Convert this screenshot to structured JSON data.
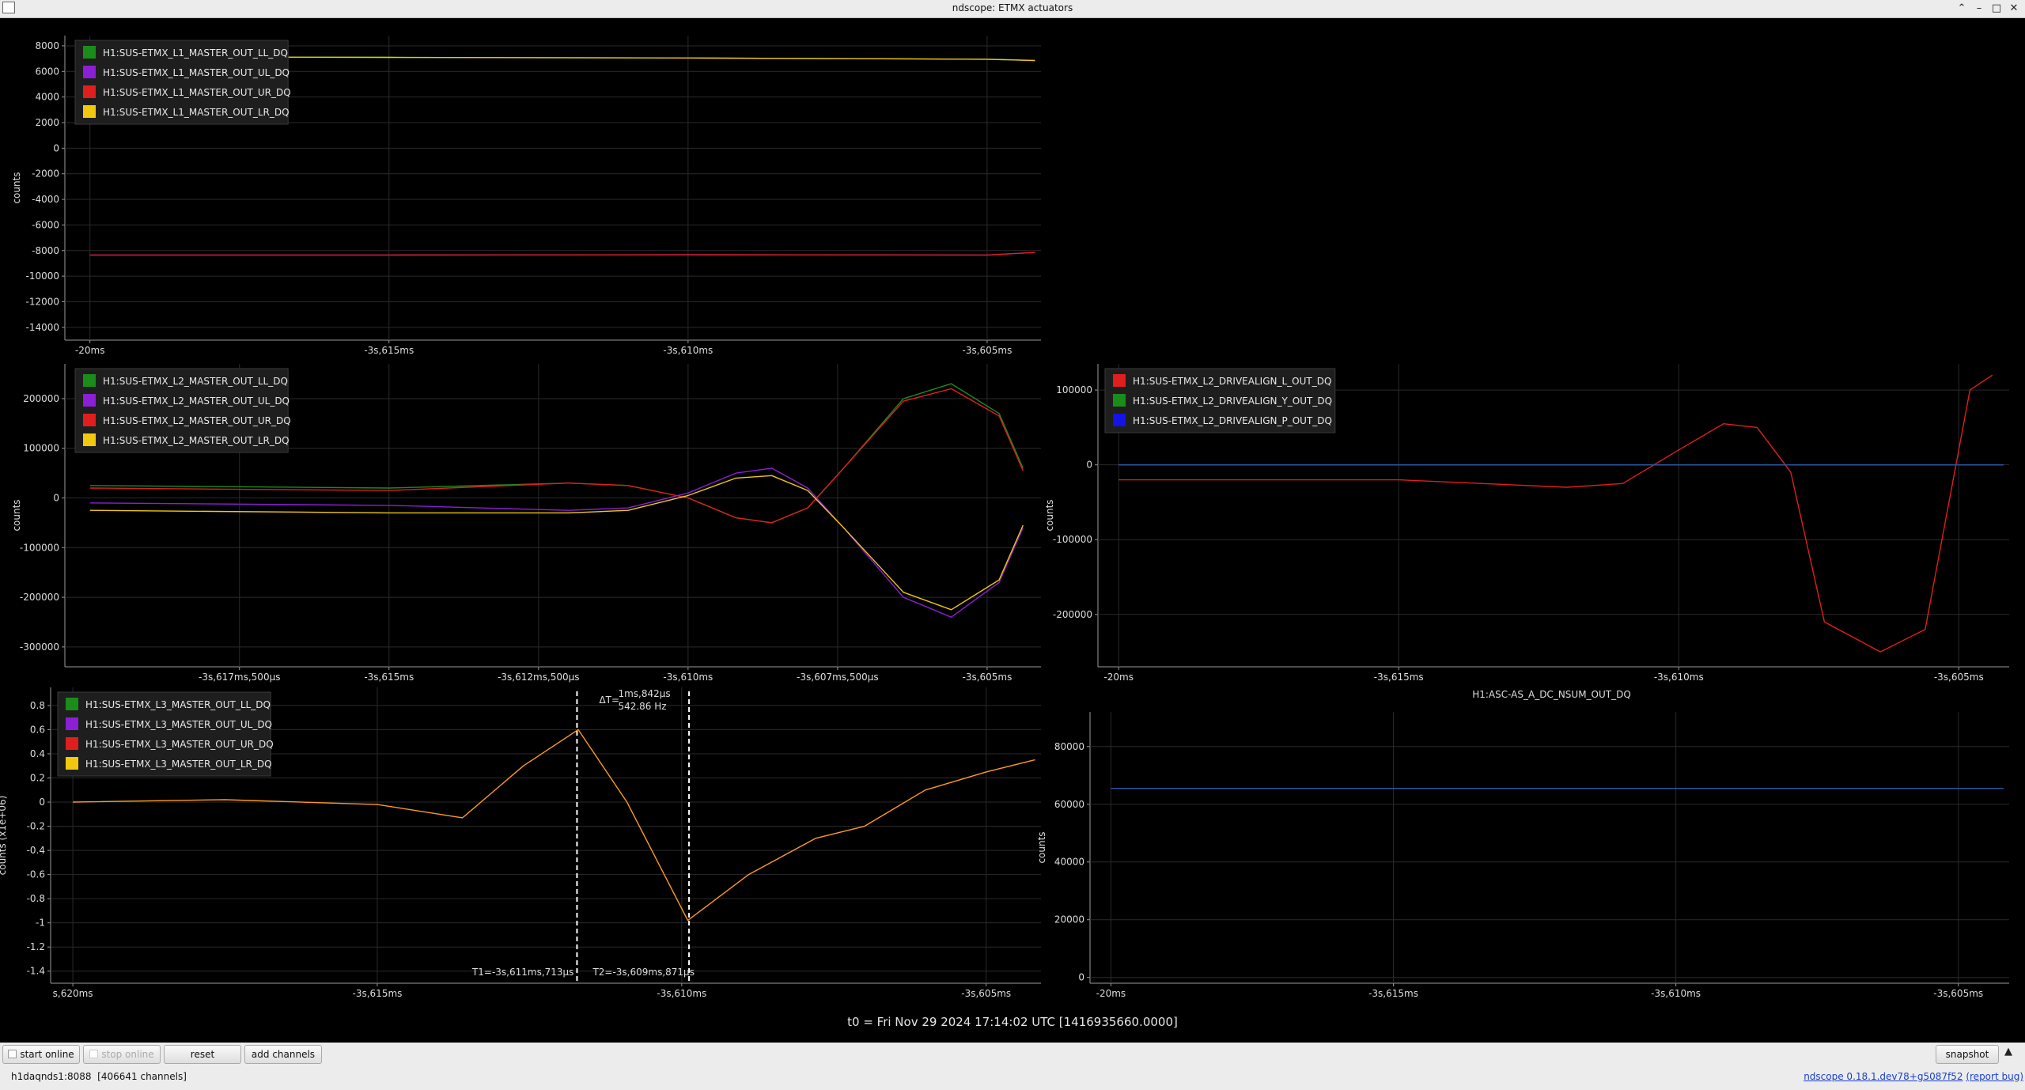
{
  "window": {
    "title": "ndscope: ETMX actuators"
  },
  "colors": {
    "green": "#1a8c1a",
    "purple": "#8a1fd6",
    "red": "#e01e1e",
    "yellow": "#f2c80f",
    "blue": "#1414e6",
    "hline": "#2858a8",
    "orange": "#ff9a1f"
  },
  "plots": [
    {
      "id": "p1",
      "ylabel": "counts",
      "title": "",
      "yticks": [
        "8000",
        "6000",
        "4000",
        "2000",
        "0",
        "-2000",
        "-4000",
        "-6000",
        "-8000",
        "-10000",
        "-12000",
        "-14000"
      ],
      "xticks": [
        "-20ms",
        "-3s,615ms",
        "-3s,610ms",
        "-3s,605ms"
      ],
      "legend": [
        {
          "label": "H1:SUS-ETMX_L1_MASTER_OUT_LL_DQ",
          "color": "green"
        },
        {
          "label": "H1:SUS-ETMX_L1_MASTER_OUT_UL_DQ",
          "color": "purple"
        },
        {
          "label": "H1:SUS-ETMX_L1_MASTER_OUT_UR_DQ",
          "color": "red"
        },
        {
          "label": "H1:SUS-ETMX_L1_MASTER_OUT_LR_DQ",
          "color": "yellow"
        }
      ]
    },
    {
      "id": "p2",
      "ylabel": "counts",
      "title": "",
      "yticks": [
        "200000",
        "100000",
        "0",
        "-100000",
        "-200000",
        "-300000"
      ],
      "xticks": [
        "-3s,617ms,500µs",
        "-3s,615ms",
        "-3s,612ms,500µs",
        "-3s,610ms",
        "-3s,607ms,500µs",
        "-3s,605ms"
      ],
      "legend": [
        {
          "label": "H1:SUS-ETMX_L2_MASTER_OUT_LL_DQ",
          "color": "green"
        },
        {
          "label": "H1:SUS-ETMX_L2_MASTER_OUT_UL_DQ",
          "color": "purple"
        },
        {
          "label": "H1:SUS-ETMX_L2_MASTER_OUT_UR_DQ",
          "color": "red"
        },
        {
          "label": "H1:SUS-ETMX_L2_MASTER_OUT_LR_DQ",
          "color": "yellow"
        }
      ]
    },
    {
      "id": "p3",
      "ylabel": "counts",
      "title": "",
      "yticks": [
        "100000",
        "0",
        "-100000",
        "-200000"
      ],
      "xticks": [
        "-20ms",
        "-3s,615ms",
        "-3s,610ms",
        "-3s,605ms"
      ],
      "legend": [
        {
          "label": "H1:SUS-ETMX_L2_DRIVEALIGN_L_OUT_DQ",
          "color": "red"
        },
        {
          "label": "H1:SUS-ETMX_L2_DRIVEALIGN_Y_OUT_DQ",
          "color": "green"
        },
        {
          "label": "H1:SUS-ETMX_L2_DRIVEALIGN_P_OUT_DQ",
          "color": "blue"
        }
      ]
    },
    {
      "id": "p4",
      "ylabel": "counts (x1e+06)",
      "title": "",
      "yticks": [
        "0.8",
        "0.6",
        "0.4",
        "0.2",
        "0",
        "-0.2",
        "-0.4",
        "-0.6",
        "-0.8",
        "-1",
        "-1.2",
        "-1.4"
      ],
      "xticks": [
        "s,620ms",
        "-3s,615ms",
        "-3s,610ms",
        "-3s,605ms"
      ],
      "legend": [
        {
          "label": "H1:SUS-ETMX_L3_MASTER_OUT_LL_DQ",
          "color": "green"
        },
        {
          "label": "H1:SUS-ETMX_L3_MASTER_OUT_UL_DQ",
          "color": "purple"
        },
        {
          "label": "H1:SUS-ETMX_L3_MASTER_OUT_UR_DQ",
          "color": "red"
        },
        {
          "label": "H1:SUS-ETMX_L3_MASTER_OUT_LR_DQ",
          "color": "yellow"
        }
      ],
      "cursors": {
        "t1": "T1=-3s,611ms,713µs",
        "t2": "T2=-3s,609ms,871µs",
        "delta_prefix": "ΔT=",
        "delta": "1ms,842µs",
        "freq": "542.86 Hz"
      }
    },
    {
      "id": "p5",
      "ylabel": "counts",
      "title": "H1:ASC-AS_A_DC_NSUM_OUT_DQ",
      "yticks": [
        "80000",
        "60000",
        "40000",
        "20000",
        "0"
      ],
      "xticks": [
        "-20ms",
        "-3s,615ms",
        "-3s,610ms",
        "-3s,605ms"
      ],
      "legend": []
    }
  ],
  "chart_data": [
    {
      "type": "line",
      "title": "",
      "ylabel": "counts",
      "ylim": [
        -15000,
        8800
      ],
      "x_ticks": [
        "-20ms",
        "-3s,615ms",
        "-3s,610ms",
        "-3s,605ms"
      ],
      "series": [
        {
          "name": "H1:SUS-ETMX_L1_MASTER_OUT_LL_DQ",
          "x": [
            -20,
            -15,
            -10,
            -5,
            -4.2
          ],
          "y": [
            7150,
            7100,
            7050,
            6950,
            6850
          ]
        },
        {
          "name": "H1:SUS-ETMX_L1_MASTER_OUT_UL_DQ",
          "x": [
            -20,
            -15,
            -10,
            -5,
            -4.2
          ],
          "y": [
            -8350,
            -8350,
            -8330,
            -8350,
            -8150
          ]
        },
        {
          "name": "H1:SUS-ETMX_L1_MASTER_OUT_UR_DQ",
          "x": [
            -20,
            -15,
            -10,
            -5,
            -4.2
          ],
          "y": [
            -8350,
            -8350,
            -8330,
            -8350,
            -8150
          ]
        },
        {
          "name": "H1:SUS-ETMX_L1_MASTER_OUT_LR_DQ",
          "x": [
            -20,
            -15,
            -10,
            -5,
            -4.2
          ],
          "y": [
            7150,
            7100,
            7050,
            6950,
            6850
          ]
        }
      ]
    },
    {
      "type": "line",
      "title": "",
      "ylabel": "counts",
      "ylim": [
        -340000,
        270000
      ],
      "x_ticks": [
        "-3s,617ms,500µs",
        "-3s,615ms",
        "-3s,612ms,500µs",
        "-3s,610ms",
        "-3s,607ms,500µs",
        "-3s,605ms"
      ],
      "series": [
        {
          "name": "H1:SUS-ETMX_L2_MASTER_OUT_LL_DQ",
          "x": [
            -20,
            -15,
            -12,
            -11,
            -10,
            -9.2,
            -8.6,
            -8,
            -7.4,
            -6.4,
            -5.6,
            -4.8,
            -4.4
          ],
          "y": [
            25000,
            20000,
            30000,
            25000,
            0,
            -40000,
            -50000,
            -20000,
            60000,
            200000,
            230000,
            170000,
            60000
          ]
        },
        {
          "name": "H1:SUS-ETMX_L2_MASTER_OUT_UL_DQ",
          "x": [
            -20,
            -15,
            -12,
            -11,
            -10,
            -9.2,
            -8.6,
            -8,
            -7.4,
            -6.4,
            -5.6,
            -4.8,
            -4.4
          ],
          "y": [
            -10000,
            -15000,
            -25000,
            -20000,
            10000,
            50000,
            60000,
            20000,
            -60000,
            -200000,
            -240000,
            -170000,
            -60000
          ]
        },
        {
          "name": "H1:SUS-ETMX_L2_MASTER_OUT_UR_DQ",
          "x": [
            -20,
            -15,
            -12,
            -11,
            -10,
            -9.2,
            -8.6,
            -8,
            -7.4,
            -6.4,
            -5.6,
            -4.8,
            -4.4
          ],
          "y": [
            20000,
            15000,
            30000,
            25000,
            0,
            -40000,
            -50000,
            -20000,
            60000,
            195000,
            220000,
            165000,
            55000
          ]
        },
        {
          "name": "H1:SUS-ETMX_L2_MASTER_OUT_LR_DQ",
          "x": [
            -20,
            -15,
            -12,
            -11,
            -10,
            -9.2,
            -8.6,
            -8,
            -7.4,
            -6.4,
            -5.6,
            -4.8,
            -4.4
          ],
          "y": [
            -25000,
            -30000,
            -30000,
            -25000,
            5000,
            40000,
            45000,
            15000,
            -60000,
            -190000,
            -225000,
            -165000,
            -55000
          ]
        }
      ]
    },
    {
      "type": "line",
      "title": "",
      "ylabel": "counts",
      "ylim": [
        -270000,
        135000
      ],
      "x_ticks": [
        "-20ms",
        "-3s,615ms",
        "-3s,610ms",
        "-3s,605ms"
      ],
      "series": [
        {
          "name": "H1:SUS-ETMX_L2_DRIVEALIGN_L_OUT_DQ",
          "x": [
            -20,
            -15,
            -12,
            -11,
            -10,
            -9.2,
            -8.6,
            -8,
            -7.4,
            -6.4,
            -5.6,
            -4.8,
            -4.4
          ],
          "y": [
            -20000,
            -20000,
            -30000,
            -25000,
            20000,
            55000,
            50000,
            -10000,
            -210000,
            -250000,
            -220000,
            100000,
            120000
          ]
        },
        {
          "name": "H1:SUS-ETMX_L2_DRIVEALIGN_Y_OUT_DQ",
          "x": [
            -20,
            -4.2
          ],
          "y": [
            0,
            0
          ]
        },
        {
          "name": "H1:SUS-ETMX_L2_DRIVEALIGN_P_OUT_DQ",
          "x": [
            -20,
            -4.2
          ],
          "y": [
            0,
            0
          ]
        }
      ]
    },
    {
      "type": "line",
      "title": "",
      "ylabel": "counts (x1e+06)",
      "ylim": [
        -1.5,
        0.95
      ],
      "x_ticks": [
        "s,620ms",
        "-3s,615ms",
        "-3s,610ms",
        "-3s,605ms"
      ],
      "series": [
        {
          "name": "H1:SUS-ETMX_L3_MASTER_OUT_LR_DQ",
          "x": [
            -20,
            -17.5,
            -15,
            -13.6,
            -12.6,
            -11.7,
            -10.9,
            -9.9,
            -8.9,
            -7.8,
            -7,
            -6,
            -5,
            -4.2
          ],
          "y": [
            0,
            0.02,
            -0.02,
            -0.13,
            0.3,
            0.6,
            0,
            -0.98,
            -0.6,
            -0.3,
            -0.2,
            0.1,
            0.25,
            0.35
          ]
        }
      ]
    },
    {
      "type": "line",
      "title": "H1:ASC-AS_A_DC_NSUM_OUT_DQ",
      "ylabel": "counts",
      "ylim": [
        -2000,
        92000
      ],
      "x_ticks": [
        "-20ms",
        "-3s,615ms",
        "-3s,610ms",
        "-3s,605ms"
      ],
      "series": [
        {
          "x": [
            -20,
            -4.2
          ],
          "y": [
            65500,
            65500
          ]
        }
      ]
    }
  ],
  "t0_label": "t0 = Fri Nov 29 2024 17:14:02 UTC [1416935660.0000]",
  "controls": {
    "start_online": "start online",
    "stop_online": "stop online",
    "reset": "reset",
    "add_channels": "add channels",
    "snapshot": "snapshot"
  },
  "status": {
    "server": "h1daqnds1:8088",
    "channels": "[406641 channels]",
    "version": "ndscope 0.18.1.dev78+g5087f52",
    "report": "(report bug)"
  }
}
